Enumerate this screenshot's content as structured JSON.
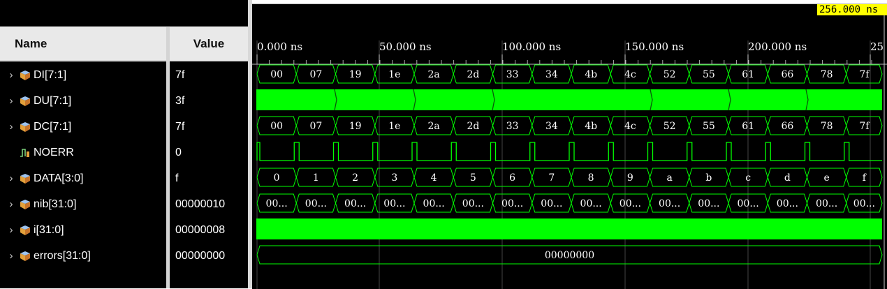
{
  "header": {
    "name_label": "Name",
    "value_label": "Value"
  },
  "cursor_label": "256.000 ns",
  "ruler": [
    "0.000 ns",
    "50.000 ns",
    "100.000 ns",
    "150.000 ns",
    "200.000 ns",
    "25"
  ],
  "signals": [
    {
      "name": "DI[7:1]",
      "value": "7f",
      "icon": "bus-signal-icon",
      "expandable": true,
      "waves": [
        "00",
        "07",
        "19",
        "1e",
        "2a",
        "2d",
        "33",
        "34",
        "4b",
        "4c",
        "52",
        "55",
        "61",
        "66",
        "78",
        "7f"
      ]
    },
    {
      "name": "DU[7:1]",
      "value": "3f",
      "icon": "bus-signal-icon",
      "expandable": true
    },
    {
      "name": "DC[7:1]",
      "value": "7f",
      "icon": "bus-signal-icon",
      "expandable": true,
      "waves": [
        "00",
        "07",
        "19",
        "1e",
        "2a",
        "2d",
        "33",
        "34",
        "4b",
        "4c",
        "52",
        "55",
        "61",
        "66",
        "78",
        "7f"
      ]
    },
    {
      "name": "NOERR",
      "value": "0",
      "icon": "bit-signal-icon",
      "expandable": false
    },
    {
      "name": "DATA[3:0]",
      "value": "f",
      "icon": "bus-signal-icon",
      "expandable": true,
      "waves": [
        "0",
        "1",
        "2",
        "3",
        "4",
        "5",
        "6",
        "7",
        "8",
        "9",
        "a",
        "b",
        "c",
        "d",
        "e",
        "f"
      ]
    },
    {
      "name": "nib[31:0]",
      "value": "00000010",
      "icon": "bus-signal-icon",
      "expandable": true,
      "waves": [
        "00...",
        "00...",
        "00...",
        "00...",
        "00...",
        "00...",
        "00...",
        "00...",
        "00...",
        "00...",
        "00...",
        "00...",
        "00...",
        "00...",
        "00...",
        "00..."
      ]
    },
    {
      "name": "i[31:0]",
      "value": "00000008",
      "icon": "bus-signal-icon",
      "expandable": true
    },
    {
      "name": "errors[31:0]",
      "value": "00000000",
      "icon": "bus-signal-icon",
      "expandable": true,
      "waves": [
        "00000000"
      ]
    }
  ],
  "colors": {
    "wave": "#00ff00",
    "background": "#000000",
    "cursor": "#ffff00"
  }
}
